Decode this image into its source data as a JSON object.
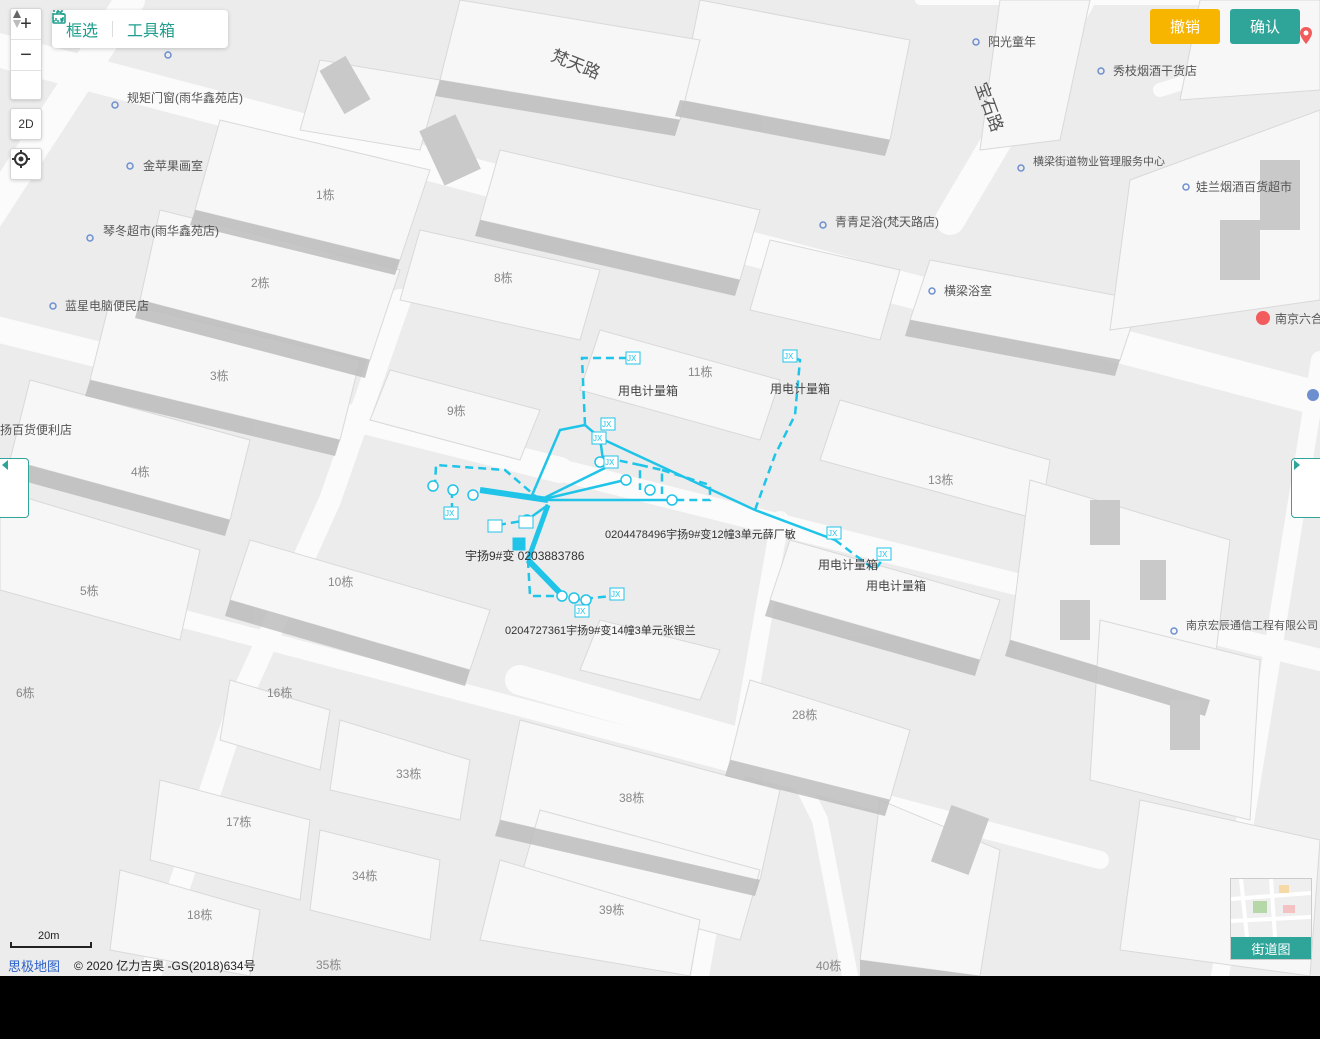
{
  "toolbar": {
    "select_label": "框选",
    "toolbox_label": "工具箱"
  },
  "zoom": {
    "in_label": "+",
    "out_label": "−"
  },
  "view_mode_label": "2D",
  "actions": {
    "cancel_label": "撤销",
    "confirm_label": "确认",
    "cancel_color": "#f7b500",
    "confirm_color": "#2fa59a"
  },
  "street_view_label": "街道图",
  "scale_label": "20m",
  "copyright": {
    "brand": "思极地图",
    "text": "© 2020 亿力吉奥 -GS(2018)634号"
  },
  "roads": [
    "梵天路",
    "宝石路"
  ],
  "pois": [
    "规矩门窗(雨华鑫苑店)",
    "金苹果画室",
    "琴冬超市(雨华鑫苑店)",
    "蓝星电脑便民店",
    "扬百货便利店",
    "阳光童年",
    "秀枝烟酒干货店",
    "横梁街道物业管理服务中心",
    "娃兰烟酒百货超市",
    "青青足浴(梵天路店)",
    "横梁浴室",
    "南京六合",
    "南京宏辰通信工程有限公司"
  ],
  "buildings": [
    "1栋",
    "2栋",
    "3栋",
    "4栋",
    "5栋",
    "6栋",
    "8栋",
    "9栋",
    "10栋",
    "11栋",
    "13栋",
    "16栋",
    "17栋",
    "18栋",
    "28栋",
    "33栋",
    "34栋",
    "35栋",
    "38栋",
    "39栋",
    "40栋"
  ],
  "meter_box_label": "用电计量箱",
  "network_labels": [
    "宇扬9#变 0203883786",
    "0204478496宇扬9#变12幢3单元薛厂敏",
    "0204727361宇扬9#变14幢3单元张银兰"
  ],
  "tag_jx": "JX",
  "network_color": "#1fc4e8"
}
